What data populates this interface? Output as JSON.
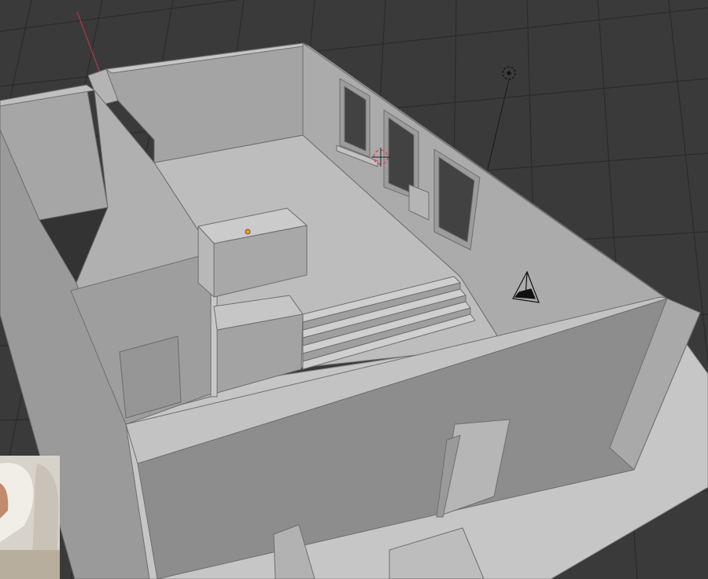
{
  "viewport": {
    "view_type": "perspective",
    "shading": "solid",
    "grid": true
  },
  "colors": {
    "background": "#3a3a3a",
    "grid_line": "#2b2b2b",
    "axis_x": "#b03a48",
    "selection_origin": "#f0a020",
    "cursor_ring": "#ff4040",
    "wall_light": "#b9b9b9",
    "wall_mid": "#a4a4a4",
    "wall_dark": "#8d8d8d",
    "floor": "#bdbdbd",
    "platform": "#c6c6c6",
    "line": "#6e6e6e"
  },
  "scene": {
    "objects": [
      {
        "name": "room-walls",
        "type": "mesh"
      },
      {
        "name": "kitchen-island",
        "type": "mesh",
        "selected": true
      },
      {
        "name": "stairs",
        "type": "mesh",
        "steps": 4
      },
      {
        "name": "window-frames",
        "type": "mesh",
        "count": 3
      },
      {
        "name": "interior-door",
        "type": "mesh"
      },
      {
        "name": "light",
        "type": "light"
      },
      {
        "name": "camera",
        "type": "camera"
      }
    ]
  },
  "overlay": {
    "webcam_inset": {
      "subject": "presenter-webcam"
    }
  }
}
